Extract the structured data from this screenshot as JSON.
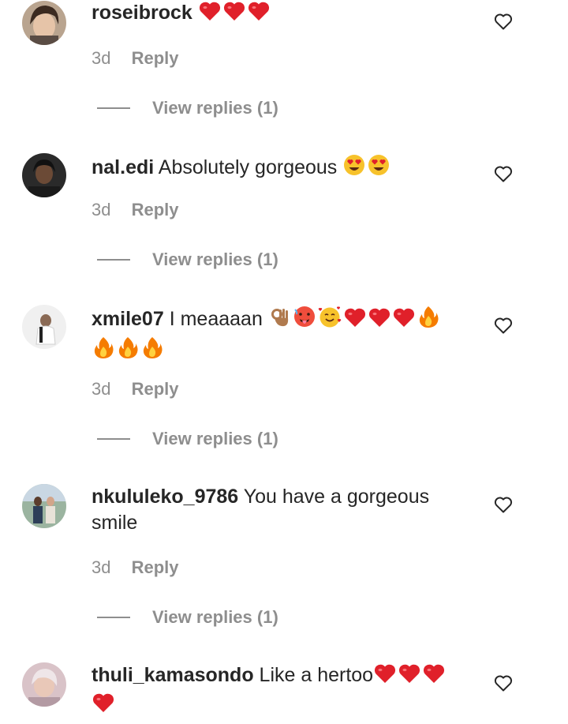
{
  "comments": [
    {
      "username": "roseibrock",
      "text": "",
      "emojis": [
        "heart",
        "heart",
        "heart"
      ],
      "emojis_line2": [],
      "time": "3d",
      "reply_label": "Reply",
      "view_replies_label": "View replies (1)"
    },
    {
      "username": "nal.edi",
      "text": "Absolutely gorgeous",
      "emojis": [
        "heart-eyes",
        "heart-eyes"
      ],
      "emojis_line2": [],
      "time": "3d",
      "reply_label": "Reply",
      "view_replies_label": "View replies (1)"
    },
    {
      "username": "xmile07",
      "text": "I meaaaan",
      "emojis": [
        "ok-hand",
        "hot-face",
        "smiling-hearts",
        "heart",
        "heart",
        "heart",
        "fire"
      ],
      "emojis_line2": [
        "fire",
        "fire",
        "fire"
      ],
      "time": "3d",
      "reply_label": "Reply",
      "view_replies_label": "View replies (1)"
    },
    {
      "username": "nkululeko_9786",
      "text": "You have a gorgeous smile",
      "emojis": [],
      "emojis_line2": [],
      "time": "3d",
      "reply_label": "Reply",
      "view_replies_label": "View replies (1)"
    },
    {
      "username": "thuli_kamasondo",
      "text": "Like a hertoo",
      "emojis": [
        "heart",
        "heart",
        "heart"
      ],
      "emojis_line2": [
        "heart"
      ],
      "time": "",
      "reply_label": "",
      "view_replies_label": ""
    }
  ],
  "colors": {
    "text": "#262626",
    "secondary": "#8e8e8e",
    "heart": "#e0202a",
    "fire": "#f57c00"
  }
}
